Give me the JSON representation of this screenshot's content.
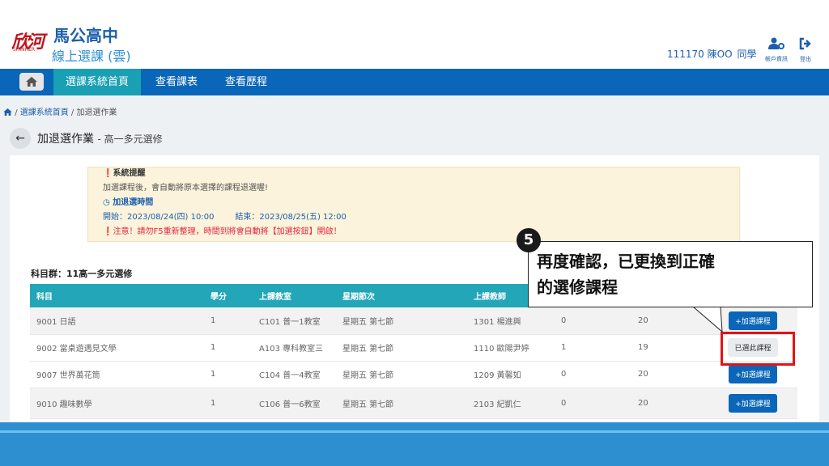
{
  "header": {
    "logo_text": "欣河",
    "logo_sub": "SHINHER",
    "school_name": "馬公高中",
    "system_name": "線上選課 (雲)",
    "user_id_name": "111170 陳OO",
    "user_role": "同學",
    "account_label": "帳戶資訊",
    "logout_label": "登出"
  },
  "nav": {
    "items": [
      "選課系統首頁",
      "查看課表",
      "查看歷程"
    ]
  },
  "breadcrumb": {
    "home": "選課系統首頁",
    "current": "加退選作業"
  },
  "page": {
    "title": "加退選作業",
    "subtitle": "- 高一多元選修"
  },
  "notice": {
    "title": "系統提醒",
    "line1": "加選課程後，會自動將原本選擇的課程退選喔!",
    "time_title": "加退選時間",
    "start": "開始：2023/08/24(四) 10:00",
    "end": "結束：2023/08/25(五) 12:00",
    "warning": "注意！請勿F5重新整理，時間到將會自動將【加選按鈕】開啟！"
  },
  "group_label": "科目群：11高一多元選修",
  "table": {
    "headers": [
      "科目",
      "學分",
      "上課教室",
      "星期節次",
      "上課教師",
      "",
      "",
      ""
    ],
    "rows": [
      {
        "subject": "9001 日語",
        "credit": "1",
        "room": "C101 普一1教室",
        "period": "星期五 第七節",
        "teacher": "1301 楊進興",
        "c1": "0",
        "c2": "20",
        "action": "+加選課程"
      },
      {
        "subject": "9002 當桌遊遇見文學",
        "credit": "1",
        "room": "A103 專科教室三",
        "period": "星期五 第七節",
        "teacher": "1110 歐陽尹婷",
        "c1": "1",
        "c2": "19",
        "action": "已選此課程"
      },
      {
        "subject": "9007 世界萬花筒",
        "credit": "1",
        "room": "C104 普一4教室",
        "period": "星期五 第七節",
        "teacher": "1209 黃馨如",
        "c1": "0",
        "c2": "20",
        "action": "+加選課程"
      },
      {
        "subject": "9010 趣味數學",
        "credit": "1",
        "room": "C106 普一6教室",
        "period": "星期五 第七節",
        "teacher": "2103 紀凱仁",
        "c1": "0",
        "c2": "20",
        "action": "+加選課程"
      }
    ]
  },
  "callout": {
    "step": "5",
    "line1": "再度確認，已更換到正確",
    "line2": "的選修課程"
  },
  "colors": {
    "nav_blue": "#0a66b8",
    "active_teal": "#1aa0b4",
    "table_header": "#23a6b8",
    "highlight_red": "#e01418",
    "notice_bg": "#fcf3dc"
  }
}
